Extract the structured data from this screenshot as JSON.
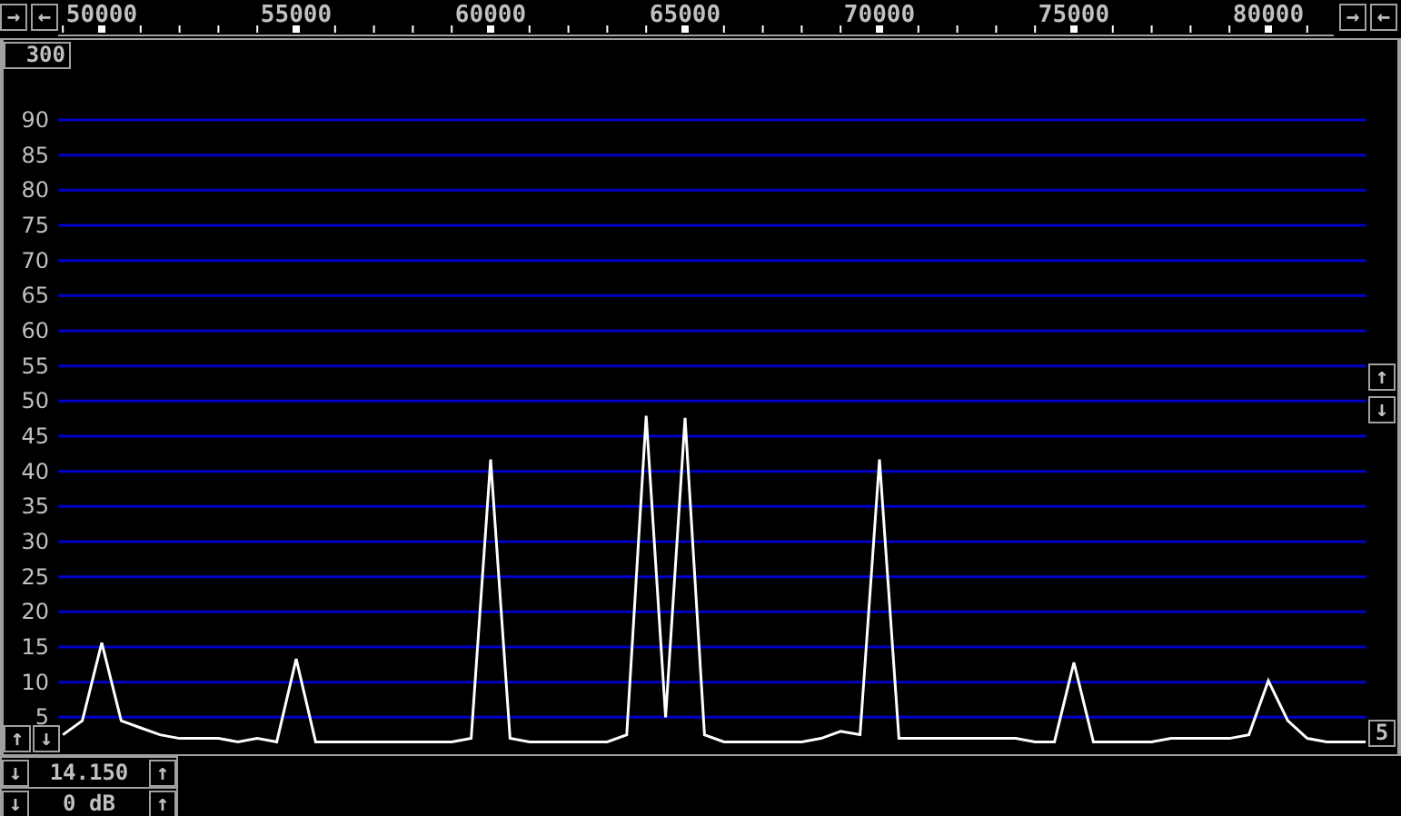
{
  "ruler": {
    "left_buttons": [
      "→",
      "←"
    ],
    "right_buttons": [
      "→",
      "←"
    ]
  },
  "range_field": "300",
  "right_buttons": [
    "↑",
    "↓"
  ],
  "step_field": "5",
  "left_buttons": [
    "↑",
    "↓"
  ],
  "spectrum": {
    "chart_data": {
      "type": "line",
      "grid": true,
      "xlim": [
        48880,
        82520
      ],
      "ylim": [
        0,
        90
      ],
      "xticks": [
        {
          "value": 50000,
          "label": "50000"
        },
        {
          "value": 55000,
          "label": "55000"
        },
        {
          "value": 60000,
          "label": "60000"
        },
        {
          "value": 65000,
          "label": "65000"
        },
        {
          "value": 70000,
          "label": "70000"
        },
        {
          "value": 75000,
          "label": "75000"
        },
        {
          "value": 80000,
          "label": "80000"
        }
      ],
      "yticks": [
        5,
        10,
        15,
        20,
        25,
        30,
        35,
        40,
        45,
        50,
        55,
        60,
        65,
        70,
        75,
        80,
        85,
        90
      ],
      "x": [
        49000,
        49500,
        50000,
        50500,
        51000,
        51500,
        52000,
        52500,
        53000,
        53500,
        54000,
        54500,
        55000,
        55500,
        56000,
        56500,
        57000,
        57500,
        58000,
        58500,
        59000,
        59500,
        60000,
        60500,
        61000,
        61500,
        62000,
        62500,
        63000,
        63500,
        64000,
        64500,
        65000,
        65500,
        66000,
        66500,
        67000,
        67500,
        68000,
        68500,
        69000,
        69500,
        70000,
        70500,
        71000,
        71500,
        72000,
        72500,
        73000,
        73500,
        74000,
        74500,
        75000,
        75500,
        76000,
        76500,
        77000,
        77500,
        78000,
        78500,
        79000,
        79500,
        80000,
        80500,
        81000,
        81500,
        82000,
        82500
      ],
      "series": [
        {
          "color": "#ffffff",
          "values": [
            2.5,
            4.5,
            15.6,
            4.5,
            3.5,
            2.5,
            2,
            2,
            2,
            1.5,
            2,
            1.5,
            13.3,
            1.5,
            1.5,
            1.5,
            1.5,
            1.5,
            1.5,
            1.5,
            1.5,
            2,
            41.7,
            2,
            1.5,
            1.5,
            1.5,
            1.5,
            1.5,
            2.5,
            47.9,
            5,
            47.6,
            2.5,
            1.5,
            1.5,
            1.5,
            1.5,
            1.5,
            2,
            3,
            2.5,
            41.7,
            2,
            2,
            2,
            2,
            2,
            2,
            2,
            1.5,
            1.5,
            12.8,
            1.5,
            1.5,
            1.5,
            1.5,
            2,
            2,
            2,
            2,
            2.5,
            10.2,
            4.5,
            2,
            1.5,
            1.5,
            1.5
          ]
        }
      ]
    }
  },
  "tuning": [
    {
      "down": "↓",
      "value": "14.150",
      "up": "↑"
    },
    {
      "down": "↓",
      "value": "0 dB",
      "up": "↑"
    }
  ]
}
